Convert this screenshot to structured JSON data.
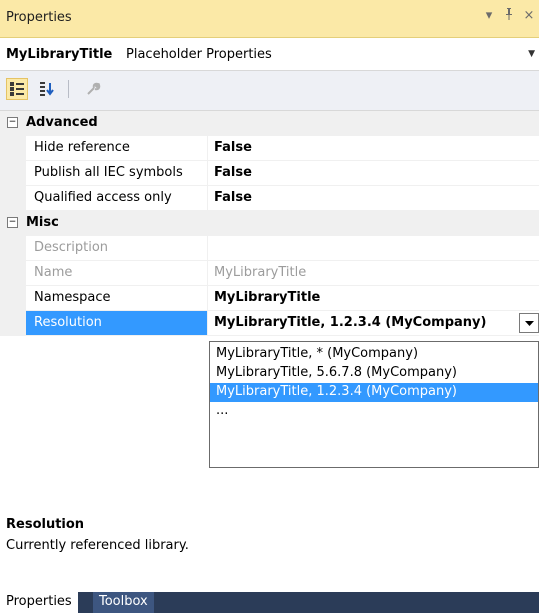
{
  "window": {
    "title": "Properties",
    "controls": {
      "dropdown": "▾",
      "pin": "ᵖ",
      "close": "×"
    }
  },
  "object_selector": {
    "name": "MyLibraryTitle",
    "type": "Placeholder Properties"
  },
  "toolbar": {
    "buttons": [
      {
        "icon": "categorized-icon",
        "active": true
      },
      {
        "icon": "alphabetical-sort-icon",
        "active": false
      },
      {
        "icon": "property-pages-icon",
        "active": false
      }
    ]
  },
  "grid": {
    "categories": [
      {
        "label": "Advanced",
        "toggle": "−",
        "properties": [
          {
            "name": "Hide reference",
            "value": "False"
          },
          {
            "name": "Publish all IEC symbols",
            "value": "False"
          },
          {
            "name": "Qualified access only",
            "value": "False"
          }
        ]
      },
      {
        "label": "Misc",
        "toggle": "−",
        "properties": [
          {
            "name": "Description",
            "value": ""
          },
          {
            "name": "Name",
            "value": "MyLibraryTitle"
          },
          {
            "name": "Namespace",
            "value": "MyLibraryTitle"
          },
          {
            "name": "Resolution",
            "value": "MyLibraryTitle, 1.2.3.4 (MyCompany)"
          }
        ]
      }
    ]
  },
  "resolution_dropdown": {
    "options": [
      "MyLibraryTitle, * (MyCompany)",
      "MyLibraryTitle, 5.6.7.8 (MyCompany)",
      "MyLibraryTitle, 1.2.3.4 (MyCompany)",
      "..."
    ],
    "selected_index": 2
  },
  "description": {
    "title": "Resolution",
    "text": "Currently referenced library."
  },
  "tabs": [
    {
      "label": "Properties",
      "active": true
    },
    {
      "label": "Toolbox",
      "active": false
    }
  ],
  "colors": {
    "title_bar": "#fbe9a7",
    "selection": "#3399ff",
    "tab_strip": "#2b3c58"
  }
}
